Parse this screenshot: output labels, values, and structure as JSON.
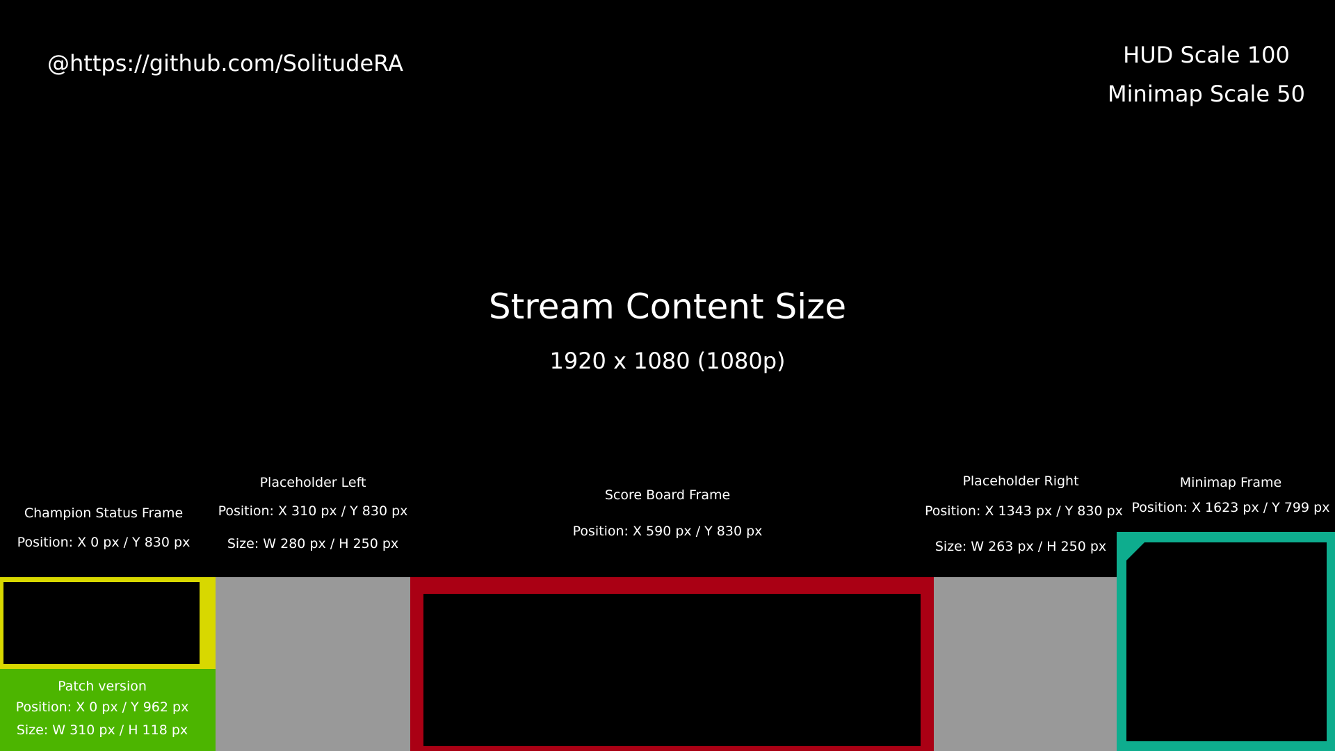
{
  "header": {
    "credit": "@https://github.com/SolitudeRA",
    "hud_scale": "HUD Scale 100",
    "minimap_scale": "Minimap Scale 50"
  },
  "stream": {
    "title": "Stream Content Size",
    "size": "1920 x 1080 (1080p)"
  },
  "frames": {
    "champion_status": {
      "title": "Champion Status Frame",
      "position": "Position: X 0 px / Y 830 px",
      "color": "#d8d800"
    },
    "placeholder_left": {
      "title": "Placeholder Left",
      "position": "Position: X 310 px / Y 830 px",
      "size": "Size: W 280 px / H 250 px",
      "color": "#999999"
    },
    "score_board": {
      "title": "Score Board Frame",
      "position": "Position: X 590 px / Y 830 px",
      "color": "#aa0014"
    },
    "placeholder_right": {
      "title": "Placeholder Right",
      "position": "Position: X 1343 px / Y 830 px",
      "size": "Size: W 263 px / H 250 px",
      "color": "#999999"
    },
    "minimap": {
      "title": "Minimap Frame",
      "position": "Position: X 1623 px / Y 799 px",
      "color": "#0ead8e"
    },
    "patch_version": {
      "title": "Patch version",
      "position": "Position: X 0 px / Y 962 px",
      "size": "Size: W 310 px / H 118 px",
      "color": "#4cb500"
    }
  }
}
